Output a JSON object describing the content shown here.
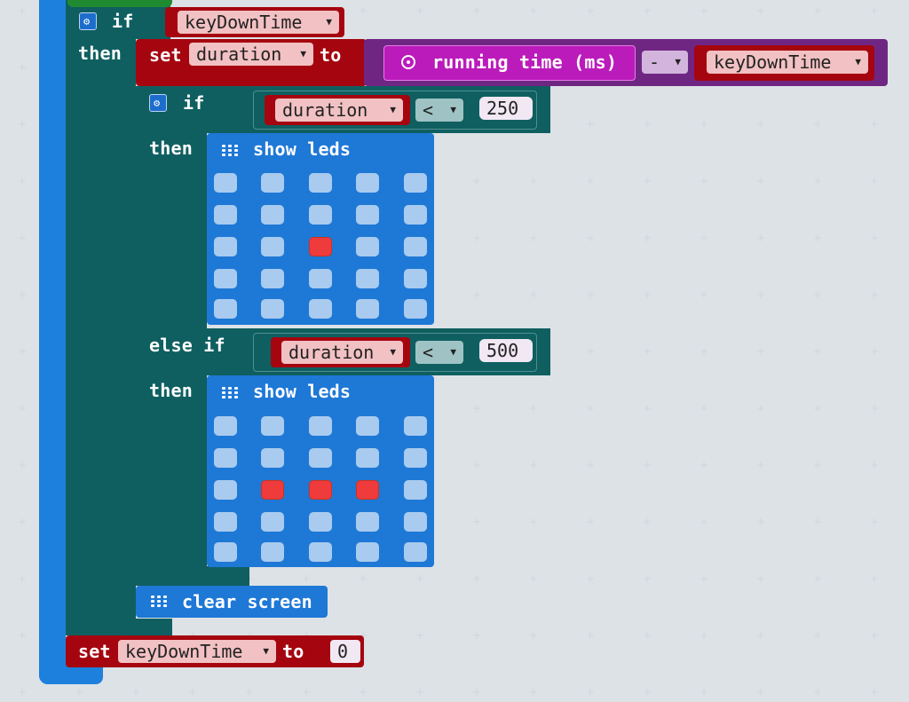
{
  "colors": {
    "loop_blue": "#1e80dd",
    "if_teal": "#0f5f61",
    "variable_red": "#a5050f",
    "pink_magenta": "#bb1bbb",
    "math_purple": "#6f2683",
    "led_block_blue": "#1e78d6",
    "led_off": "#a9cbef",
    "led_on": "#ef3b3b",
    "background": "#ecf0f2"
  },
  "outer_if": {
    "if_label": "if",
    "then_label": "then",
    "condition_var": "keyDownTime"
  },
  "set_duration": {
    "set_label": "set",
    "var": "duration",
    "to_label": "to",
    "running_time_label": "running time (ms)",
    "operator": "-",
    "rhs_var": "keyDownTime"
  },
  "inner_if": {
    "if_label": "if",
    "then_label": "then",
    "compare_var": "duration",
    "compare_op": "<",
    "compare_value": "250"
  },
  "else_if": {
    "label": "else if",
    "then_label": "then",
    "compare_var": "duration",
    "compare_op": "<",
    "compare_value": "500"
  },
  "show_leds_1": {
    "label": "show leds",
    "leds": [
      [
        0,
        0,
        0,
        0,
        0
      ],
      [
        0,
        0,
        0,
        0,
        0
      ],
      [
        0,
        0,
        1,
        0,
        0
      ],
      [
        0,
        0,
        0,
        0,
        0
      ],
      [
        0,
        0,
        0,
        0,
        0
      ]
    ]
  },
  "show_leds_2": {
    "label": "show leds",
    "leds": [
      [
        0,
        0,
        0,
        0,
        0
      ],
      [
        0,
        0,
        0,
        0,
        0
      ],
      [
        0,
        1,
        1,
        1,
        0
      ],
      [
        0,
        0,
        0,
        0,
        0
      ],
      [
        0,
        0,
        0,
        0,
        0
      ]
    ]
  },
  "clear_screen": {
    "label": "clear screen"
  },
  "set_keydown": {
    "set_label": "set",
    "var": "keyDownTime",
    "to_label": "to",
    "value": "0"
  }
}
